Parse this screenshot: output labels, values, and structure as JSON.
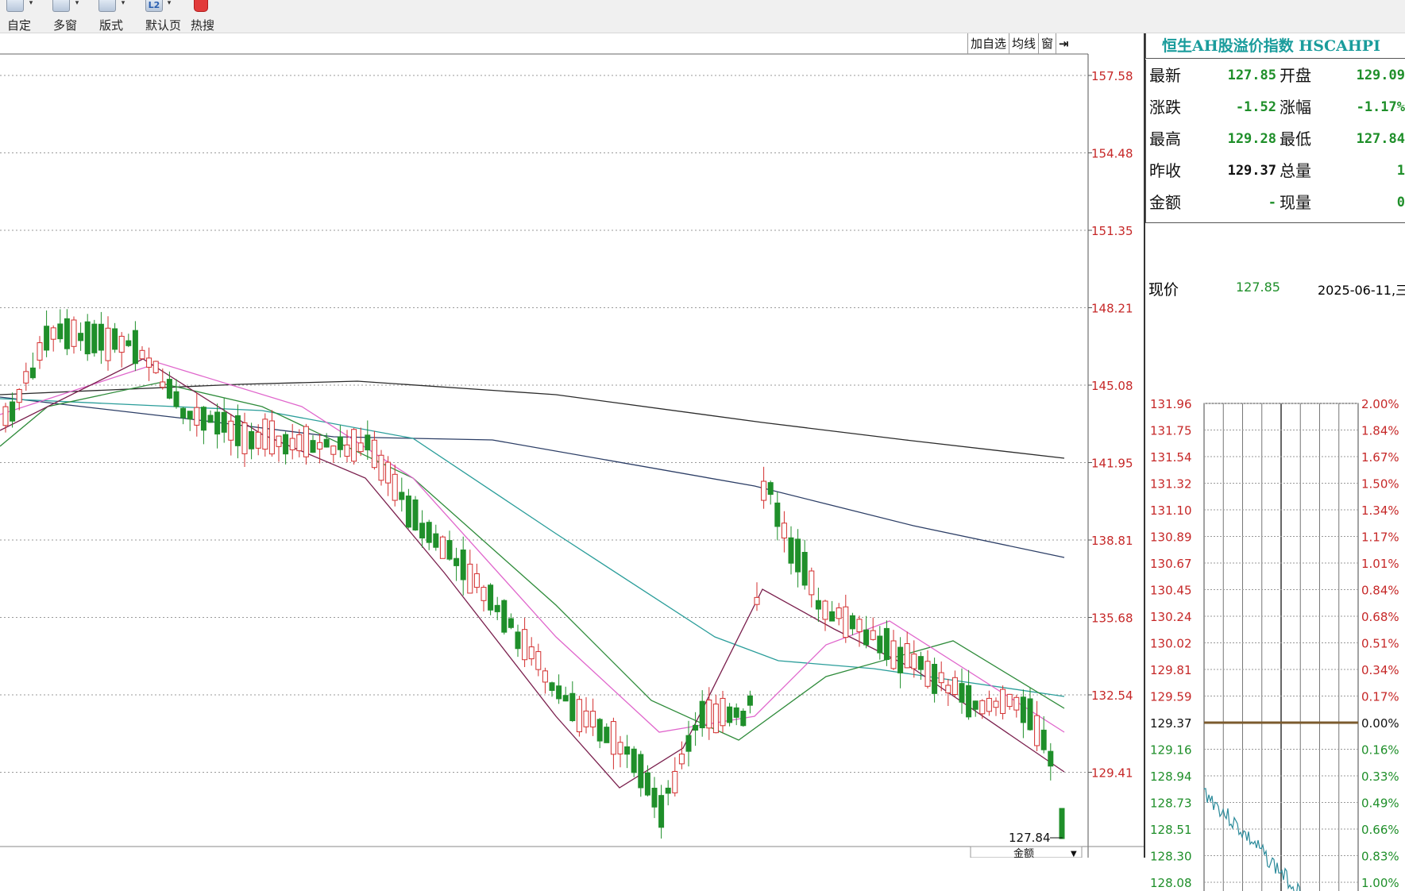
{
  "toolbar": {
    "buttons": [
      {
        "label": "自定",
        "icon": "custom-icon"
      },
      {
        "label": "多窗",
        "icon": "multi-window-icon"
      },
      {
        "label": "版式",
        "icon": "layout-icon"
      },
      {
        "label": "默认页",
        "icon": "l2-icon",
        "badge": "L2"
      },
      {
        "label": "热搜",
        "icon": "hot-search-icon"
      }
    ]
  },
  "chart_tabs": [
    "加自选",
    "均线",
    "窗",
    "⇥"
  ],
  "price_axis": {
    "ticks": [
      "157.58",
      "154.48",
      "151.35",
      "148.21",
      "145.08",
      "141.95",
      "138.81",
      "135.68",
      "132.54",
      "129.41"
    ],
    "last_low_label": "127.84"
  },
  "bottom_label": "金额",
  "quote": {
    "title": "恒生AH股溢价指数 HSCAHPI",
    "rows": [
      {
        "l1": "最新",
        "v1": "127.85",
        "c1": "green",
        "l2": "开盘",
        "v2": "129.09",
        "c2": "green"
      },
      {
        "l1": "涨跌",
        "v1": "-1.52",
        "c1": "green",
        "l2": "涨幅",
        "v2": "-1.17%",
        "c2": "green"
      },
      {
        "l1": "最高",
        "v1": "129.28",
        "c1": "green",
        "l2": "最低",
        "v2": "127.84",
        "c2": "green"
      },
      {
        "l1": "昨收",
        "v1": "129.37",
        "c1": "black",
        "l2": "总量",
        "v2": "1",
        "c2": "green"
      },
      {
        "l1": "金额",
        "v1": "-",
        "c1": "green",
        "l2": "现量",
        "v2": "0",
        "c2": "green"
      }
    ]
  },
  "now": {
    "label": "现价",
    "price": "127.85",
    "date": "2025-06-11,三"
  },
  "mini_chart": {
    "left_ticks": [
      "131.96",
      "131.75",
      "131.54",
      "131.32",
      "131.10",
      "130.89",
      "130.67",
      "130.45",
      "130.24",
      "130.02",
      "129.81",
      "129.59",
      "129.37",
      "129.16",
      "128.94",
      "128.73",
      "128.51",
      "128.30",
      "128.08"
    ],
    "right_ticks": [
      "2.00%",
      "1.84%",
      "1.67%",
      "1.50%",
      "1.34%",
      "1.17%",
      "1.01%",
      "0.84%",
      "0.68%",
      "0.51%",
      "0.34%",
      "0.17%",
      "0.00%",
      "0.16%",
      "0.33%",
      "0.49%",
      "0.66%",
      "0.83%",
      "1.00%"
    ]
  },
  "colors": {
    "up": "#d32f2f",
    "down": "#1f8f2a",
    "accent": "#1a9c9c"
  }
}
